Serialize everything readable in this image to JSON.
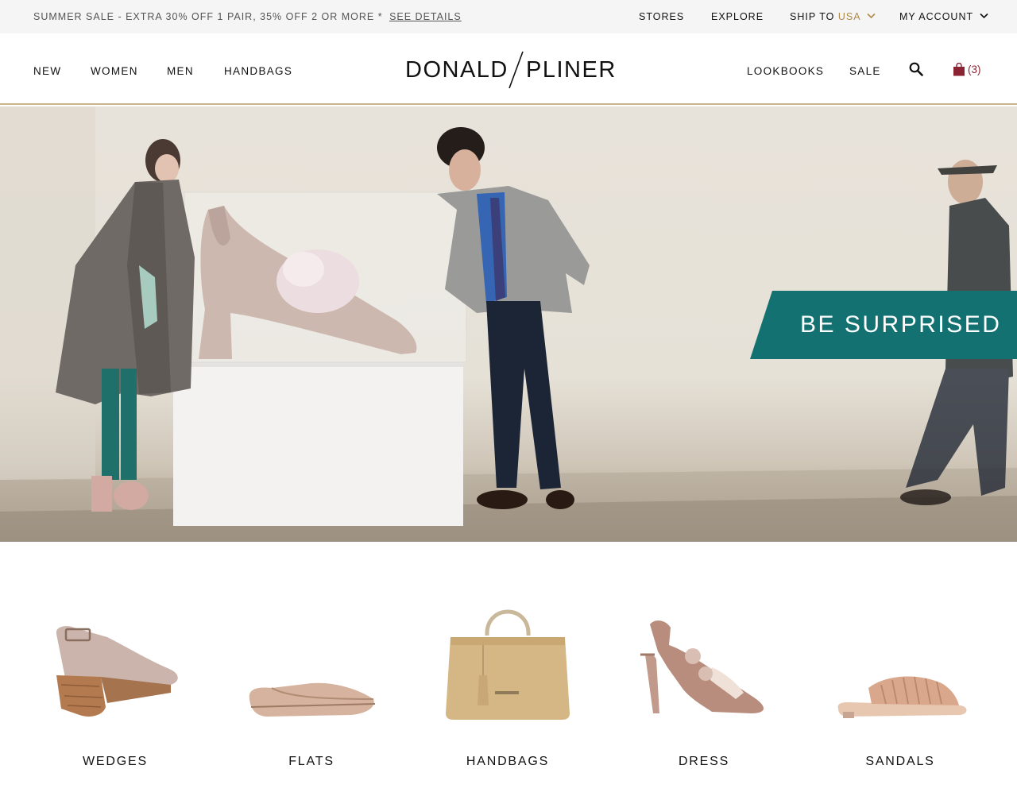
{
  "promo": {
    "text": "SUMMER SALE - EXTRA 30% OFF 1 PAIR, 35% OFF 2 OR MORE *",
    "link": "SEE DETAILS"
  },
  "utility_nav": {
    "stores": "STORES",
    "explore": "EXPLORE",
    "ship_to_label": "SHIP TO",
    "ship_to_country": "USA",
    "account": "MY ACCOUNT"
  },
  "main_nav": {
    "left": [
      "NEW",
      "WOMEN",
      "MEN",
      "HANDBAGS"
    ],
    "right": [
      "LOOKBOOKS",
      "SALE"
    ]
  },
  "logo": {
    "left": "DONALD",
    "right": "PLINER"
  },
  "cart": {
    "count": "(3)"
  },
  "hero": {
    "banner_text": "BE SURPRISED"
  },
  "categories": [
    {
      "label": "WEDGES",
      "icon": "wedge-shoe-image"
    },
    {
      "label": "FLATS",
      "icon": "flat-shoe-image"
    },
    {
      "label": "HANDBAGS",
      "icon": "handbag-image"
    },
    {
      "label": "DRESS",
      "icon": "dress-heel-image"
    },
    {
      "label": "SANDALS",
      "icon": "slide-sandal-image"
    }
  ],
  "colors": {
    "accent_gold": "#b08a47",
    "banner_teal": "#137172",
    "cart_red": "#8a2433",
    "header_rule": "#c9b58a"
  }
}
